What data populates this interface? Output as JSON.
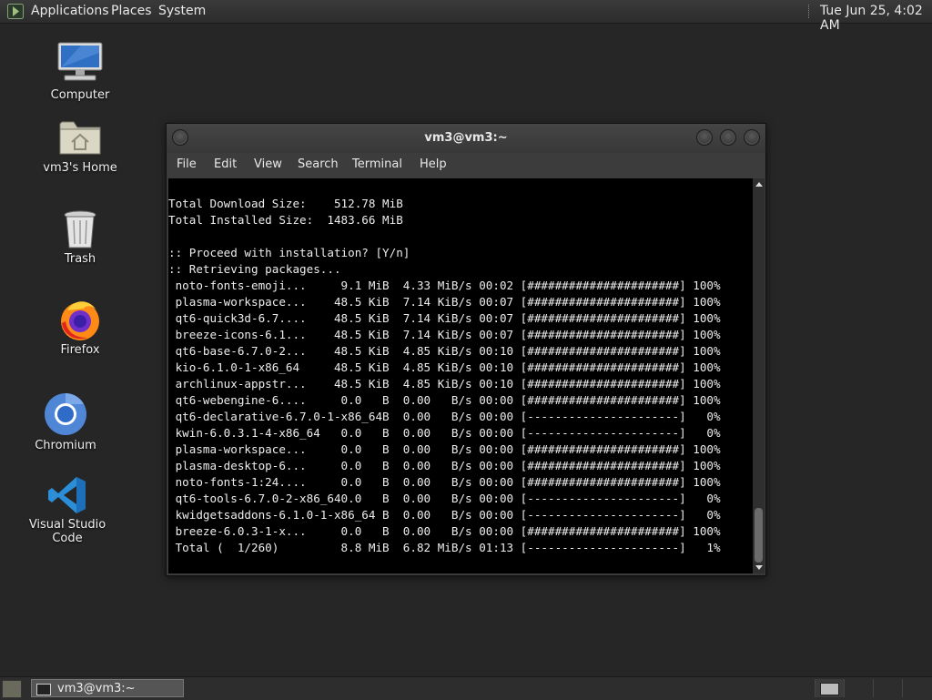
{
  "top_panel": {
    "menus": [
      "Applications",
      "Places",
      "System"
    ],
    "clock": "Tue Jun 25,  4:02 AM"
  },
  "desktop": {
    "icons": [
      {
        "label": "Computer",
        "icon": "computer-icon"
      },
      {
        "label": "vm3's Home",
        "icon": "home-folder-icon"
      },
      {
        "label": "Trash",
        "icon": "trash-icon"
      },
      {
        "label": "Firefox",
        "icon": "firefox-icon"
      },
      {
        "label": "Chromium",
        "icon": "chromium-icon"
      },
      {
        "label": "Visual Studio Code",
        "icon": "vscode-icon"
      }
    ]
  },
  "terminal": {
    "title": "vm3@vm3:~",
    "menu": [
      "File",
      "Edit",
      "View",
      "Search",
      "Terminal",
      "Help"
    ],
    "lines": [
      "Total Download Size:    512.78 MiB",
      "Total Installed Size:  1483.66 MiB",
      "",
      ":: Proceed with installation? [Y/n]",
      ":: Retrieving packages...",
      " noto-fonts-emoji...     9.1 MiB  4.33 MiB/s 00:02 [######################] 100%",
      " plasma-workspace...    48.5 KiB  7.14 KiB/s 00:07 [######################] 100%",
      " qt6-quick3d-6.7....    48.5 KiB  7.14 KiB/s 00:07 [######################] 100%",
      " breeze-icons-6.1...    48.5 KiB  7.14 KiB/s 00:07 [######################] 100%",
      " qt6-base-6.7.0-2...    48.5 KiB  4.85 KiB/s 00:10 [######################] 100%",
      " kio-6.1.0-1-x86_64     48.5 KiB  4.85 KiB/s 00:10 [######################] 100%",
      " archlinux-appstr...    48.5 KiB  4.85 KiB/s 00:10 [######################] 100%",
      " qt6-webengine-6....     0.0   B  0.00   B/s 00:00 [######################] 100%",
      " qt6-declarative-6.7.0-1-x86_64B  0.00   B/s 00:00 [----------------------]   0%",
      " kwin-6.0.3.1-4-x86_64   0.0   B  0.00   B/s 00:00 [----------------------]   0%",
      " plasma-workspace...     0.0   B  0.00   B/s 00:00 [######################] 100%",
      " plasma-desktop-6...     0.0   B  0.00   B/s 00:00 [######################] 100%",
      " noto-fonts-1:24....     0.0   B  0.00   B/s 00:00 [######################] 100%",
      " qt6-tools-6.7.0-2-x86_640.0   B  0.00   B/s 00:00 [----------------------]   0%",
      " kwidgetsaddons-6.1.0-1-x86_64 B  0.00   B/s 00:00 [----------------------]   0%",
      " breeze-6.0.3-1-x...     0.0   B  0.00   B/s 00:00 [######################] 100%",
      " Total (  1/260)         8.8 MiB  6.82 MiB/s 01:13 [----------------------]   1%"
    ]
  },
  "taskbar": {
    "tasks": [
      {
        "label": "vm3@vm3:~"
      }
    ],
    "workspaces": 4
  }
}
